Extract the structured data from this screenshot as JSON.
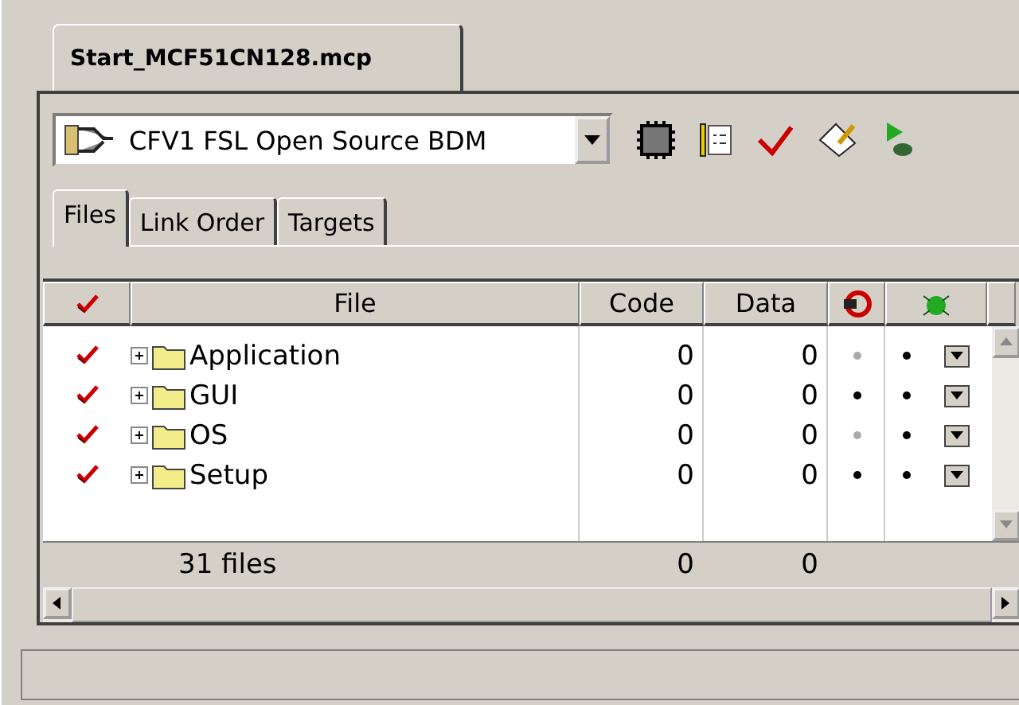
{
  "document_tab": {
    "label": "Start_MCF51CN128.mcp",
    "selected": true
  },
  "target_select": {
    "value": "CFV1 FSL Open Source BDM"
  },
  "tabs": [
    {
      "label": "Files",
      "selected": true
    },
    {
      "label": "Link Order",
      "selected": false
    },
    {
      "label": "Targets",
      "selected": false
    }
  ],
  "table": {
    "columns": [
      "File",
      "Code",
      "Data"
    ],
    "rows": [
      {
        "name": "Application",
        "code": "0",
        "data": "0",
        "checked": true,
        "expanded": false,
        "column_5_set": false,
        "column_6_set": true
      },
      {
        "name": "GUI",
        "code": "0",
        "data": "0",
        "checked": true,
        "expanded": false,
        "column_5_set": true,
        "column_6_set": true
      },
      {
        "name": "OS",
        "code": "0",
        "data": "0",
        "checked": true,
        "expanded": false,
        "column_5_set": false,
        "column_6_set": true
      },
      {
        "name": "Setup",
        "code": "0",
        "data": "0",
        "checked": true,
        "expanded": false,
        "column_5_set": true,
        "column_6_set": true
      }
    ],
    "footer": {
      "count": "31 files",
      "code": "0",
      "data": "0"
    }
  }
}
